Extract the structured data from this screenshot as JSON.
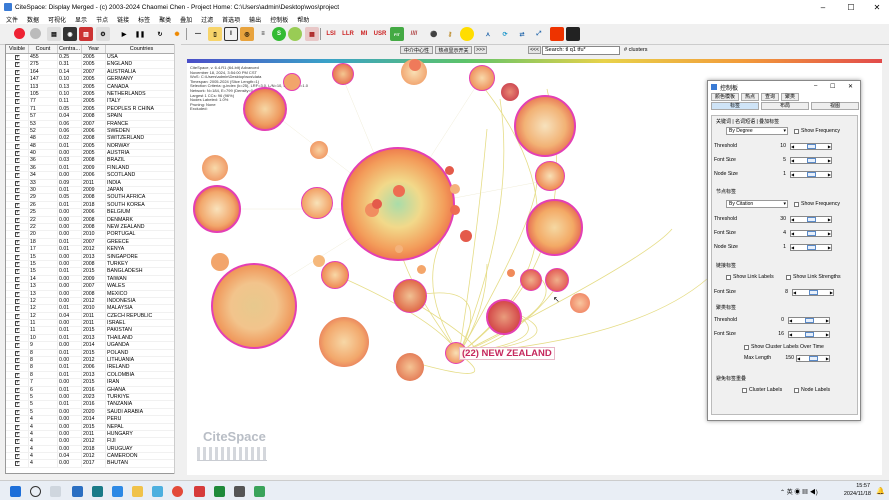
{
  "window": {
    "title": "CiteSpace: Display Merged - (c) 2003-2024 Chaomei Chen - Project Home: C:\\Users\\admin\\Desktop\\wos\\project"
  },
  "menu": [
    "文件",
    "数据",
    "可视化",
    "显示",
    "节点",
    "链接",
    "标签",
    "聚类",
    "叠加",
    "过滤",
    "首选项",
    "输出",
    "控制板",
    "帮助"
  ],
  "toolbar": {
    "buttons_right": [
      "LSI",
      "LLR",
      "MI",
      "USR"
    ],
    "nav_buttons": [
      "中介中心性",
      "热点显示开关",
      ">>>",
      "<<<"
    ],
    "search_placeholder": "Search: tl q1 tfu*",
    "clusters_label": "# clusters"
  },
  "table": {
    "headers": [
      "Visible",
      "Count",
      "Centra...",
      "Year",
      "Countries"
    ],
    "rows": [
      [
        "455",
        "0.25",
        "2005",
        "USA"
      ],
      [
        "275",
        "0.31",
        "2005",
        "ENGLAND"
      ],
      [
        "164",
        "0.14",
        "2007",
        "AUSTRALIA"
      ],
      [
        "147",
        "0.10",
        "2005",
        "GERMANY"
      ],
      [
        "113",
        "0.13",
        "2005",
        "CANADA"
      ],
      [
        "105",
        "0.10",
        "2005",
        "NETHERLANDS"
      ],
      [
        "77",
        "0.11",
        "2005",
        "ITALY"
      ],
      [
        "71",
        "0.05",
        "2005",
        "PEOPLES R CHINA"
      ],
      [
        "57",
        "0.04",
        "2008",
        "SPAIN"
      ],
      [
        "53",
        "0.06",
        "2007",
        "FRANCE"
      ],
      [
        "52",
        "0.06",
        "2006",
        "SWEDEN"
      ],
      [
        "48",
        "0.02",
        "2008",
        "SWITZERLAND"
      ],
      [
        "48",
        "0.01",
        "2005",
        "NORWAY"
      ],
      [
        "40",
        "0.00",
        "2005",
        "AUSTRIA"
      ],
      [
        "36",
        "0.03",
        "2008",
        "BRAZIL"
      ],
      [
        "36",
        "0.01",
        "2009",
        "FINLAND"
      ],
      [
        "34",
        "0.00",
        "2006",
        "SCOTLAND"
      ],
      [
        "33",
        "0.09",
        "2011",
        "INDIA"
      ],
      [
        "30",
        "0.01",
        "2009",
        "JAPAN"
      ],
      [
        "29",
        "0.05",
        "2008",
        "SOUTH AFRICA"
      ],
      [
        "26",
        "0.01",
        "2018",
        "SOUTH KOREA"
      ],
      [
        "25",
        "0.00",
        "2006",
        "BELGIUM"
      ],
      [
        "22",
        "0.00",
        "2008",
        "DENMARK"
      ],
      [
        "22",
        "0.00",
        "2008",
        "NEW ZEALAND"
      ],
      [
        "20",
        "0.00",
        "2010",
        "PORTUGAL"
      ],
      [
        "18",
        "0.01",
        "2007",
        "GREECE"
      ],
      [
        "17",
        "0.01",
        "2012",
        "KENYA"
      ],
      [
        "15",
        "0.00",
        "2013",
        "SINGAPORE"
      ],
      [
        "15",
        "0.00",
        "2008",
        "TURKEY"
      ],
      [
        "15",
        "0.01",
        "2015",
        "BANGLADESH"
      ],
      [
        "14",
        "0.00",
        "2009",
        "TAIWAN"
      ],
      [
        "13",
        "0.00",
        "2007",
        "WALES"
      ],
      [
        "13",
        "0.00",
        "2008",
        "MEXICO"
      ],
      [
        "12",
        "0.00",
        "2012",
        "INDONESIA"
      ],
      [
        "12",
        "0.01",
        "2010",
        "MALAYSIA"
      ],
      [
        "12",
        "0.04",
        "2011",
        "CZECH REPUBLIC"
      ],
      [
        "11",
        "0.00",
        "2011",
        "ISRAEL"
      ],
      [
        "11",
        "0.01",
        "2015",
        "PAKISTAN"
      ],
      [
        "10",
        "0.01",
        "2013",
        "THAILAND"
      ],
      [
        "9",
        "0.00",
        "2014",
        "UGANDA"
      ],
      [
        "8",
        "0.01",
        "2015",
        "POLAND"
      ],
      [
        "8",
        "0.00",
        "2012",
        "LITHUANIA"
      ],
      [
        "8",
        "0.01",
        "2006",
        "IRELAND"
      ],
      [
        "8",
        "0.01",
        "2013",
        "COLOMBIA"
      ],
      [
        "7",
        "0.00",
        "2015",
        "IRAN"
      ],
      [
        "6",
        "0.01",
        "2016",
        "GHANA"
      ],
      [
        "5",
        "0.00",
        "2023",
        "TURKIYE"
      ],
      [
        "5",
        "0.01",
        "2016",
        "TANZANIA"
      ],
      [
        "5",
        "0.00",
        "2020",
        "SAUDI ARABIA"
      ],
      [
        "4",
        "0.00",
        "2014",
        "PERU"
      ],
      [
        "4",
        "0.00",
        "2015",
        "NEPAL"
      ],
      [
        "4",
        "0.00",
        "2011",
        "HUNGARY"
      ],
      [
        "4",
        "0.00",
        "2012",
        "FIJI"
      ],
      [
        "4",
        "0.00",
        "2018",
        "URUGUAY"
      ],
      [
        "4",
        "0.04",
        "2012",
        "CAMEROON"
      ],
      [
        "4",
        "0.00",
        "2017",
        "BHUTAN"
      ]
    ]
  },
  "canvas": {
    "legend": [
      "CiteSpace, v. 6.4.R1 (64-bit) Advanced",
      "November 18, 2024, 3:54:00 PM CST",
      "WoS: C:\\Users\\admin\\Desktop\\wos\\data",
      "Timespan: 2005-2024 (Slice Length=1)",
      "Selection Criteria: g-index (k=25), LRF=3.0, L/N=10, LBY=5, e=1.0",
      "Network: N=184, E=799 (Density=0.0475)",
      "Largest 1 CCs: 96 (96%)",
      "Nodes Labeled: 1.0%",
      "Pruning: None",
      "Excluded:"
    ],
    "highlight_label": "(22) NEW ZEALAND",
    "watermark": "CiteSpace"
  },
  "control_panel": {
    "title": "控制板",
    "tabs_row1": [
      "颜色模板",
      "热点",
      "查询",
      "聚类"
    ],
    "tabs_row2": [
      "标签",
      "布局",
      "视图"
    ],
    "subtabs": "关键词 | 名词短语 | 叠加标签",
    "node_label_section": "节点标签",
    "link_label_section": "链接标签",
    "cluster_label_section": "聚类标签",
    "avoid_overlap_section": "避免标签重叠",
    "by_degree": "By Degree",
    "by_citation": "By Citation",
    "show_frequency": "Show Frequency",
    "threshold": "Threshold",
    "font_size": "Font Size",
    "node_size": "Node Size",
    "kw_threshold": "10",
    "kw_font": "5",
    "kw_node": "1",
    "nd_threshold": "30",
    "nd_font": "4",
    "nd_node": "1",
    "show_link_labels": "Show Link Labels",
    "show_link_strengths": "Show Link Strengths",
    "ln_font": "8",
    "cl_threshold": "0",
    "cl_font": "16",
    "show_cluster_over_time": "Show Cluster Labels Over Time",
    "max_length_label": "Max Length",
    "max_length": "150",
    "cluster_labels": "Cluster Labels",
    "node_labels": "Node Labels"
  },
  "taskbar": {
    "time": "15:57",
    "date": "2024/11/18"
  }
}
